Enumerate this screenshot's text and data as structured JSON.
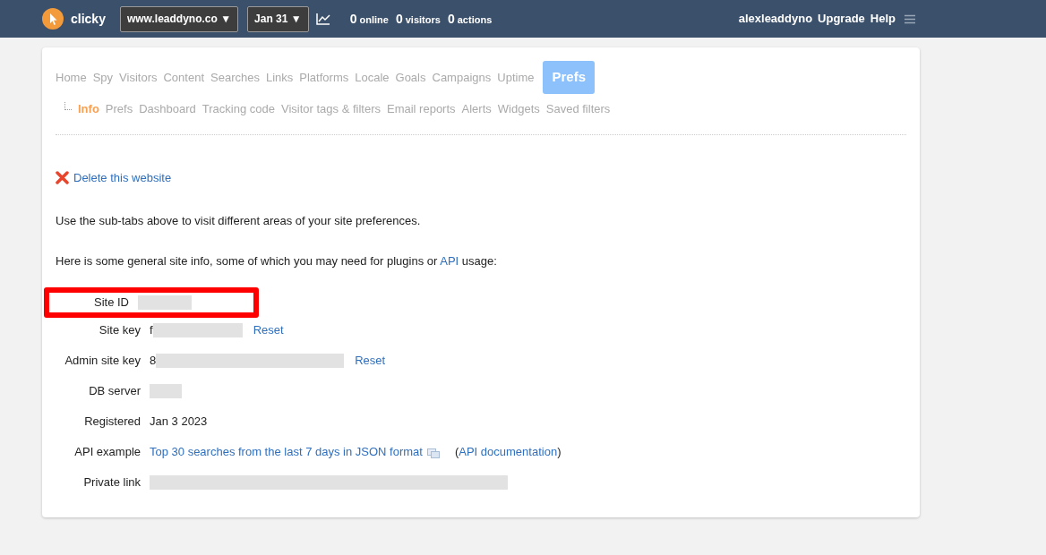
{
  "topbar": {
    "brand": "clicky",
    "site_select": "www.leaddyno.co ▼",
    "date_select": "Jan 31 ▼",
    "stats": [
      {
        "count": "0",
        "label": "online"
      },
      {
        "count": "0",
        "label": "visitors"
      },
      {
        "count": "0",
        "label": "actions"
      }
    ],
    "user": "alexleaddyno",
    "links": [
      "Upgrade",
      "Help"
    ]
  },
  "tabs": [
    {
      "label": "Home",
      "selected": false
    },
    {
      "label": "Spy",
      "selected": false
    },
    {
      "label": "Visitors",
      "selected": false
    },
    {
      "label": "Content",
      "selected": false
    },
    {
      "label": "Searches",
      "selected": false
    },
    {
      "label": "Links",
      "selected": false
    },
    {
      "label": "Platforms",
      "selected": false
    },
    {
      "label": "Locale",
      "selected": false
    },
    {
      "label": "Goals",
      "selected": false
    },
    {
      "label": "Campaigns",
      "selected": false
    },
    {
      "label": "Uptime",
      "selected": false
    },
    {
      "label": "Prefs",
      "selected": true
    }
  ],
  "subtabs": [
    {
      "label": "Info",
      "selected": true
    },
    {
      "label": "Prefs",
      "selected": false
    },
    {
      "label": "Dashboard",
      "selected": false
    },
    {
      "label": "Tracking code",
      "selected": false
    },
    {
      "label": "Visitor tags & filters",
      "selected": false
    },
    {
      "label": "Email reports",
      "selected": false
    },
    {
      "label": "Alerts",
      "selected": false
    },
    {
      "label": "Widgets",
      "selected": false
    },
    {
      "label": "Saved filters",
      "selected": false
    }
  ],
  "delete_link": "Delete this website",
  "intro": "Use the sub-tabs above to visit different areas of your site preferences.",
  "info_text": {
    "before": "Here is some general site info, some of which you may need for plugins or",
    "link": "API",
    "after": "usage:"
  },
  "fields": [
    {
      "label": "Site ID",
      "kind": "redacted",
      "highlighted": true
    },
    {
      "label": "Site key",
      "kind": "redacted",
      "value": "f",
      "action": "Reset",
      "highlighted": false
    },
    {
      "label": "Admin site key",
      "kind": "redacted",
      "value": "8",
      "action": "Reset",
      "highlighted": false
    },
    {
      "label": "DB server",
      "kind": "redacted",
      "highlighted": false
    },
    {
      "label": "Registered",
      "kind": "text",
      "value": "Jan 3 2023",
      "highlighted": false
    },
    {
      "label": "API example",
      "kind": "api",
      "link": "Top 30 searches from the last 7 days in JSON format",
      "open": "(",
      "doc_link": "API documentation",
      "close": ")",
      "highlighted": false
    },
    {
      "label": "Private link",
      "kind": "redacted",
      "highlighted": false
    }
  ]
}
